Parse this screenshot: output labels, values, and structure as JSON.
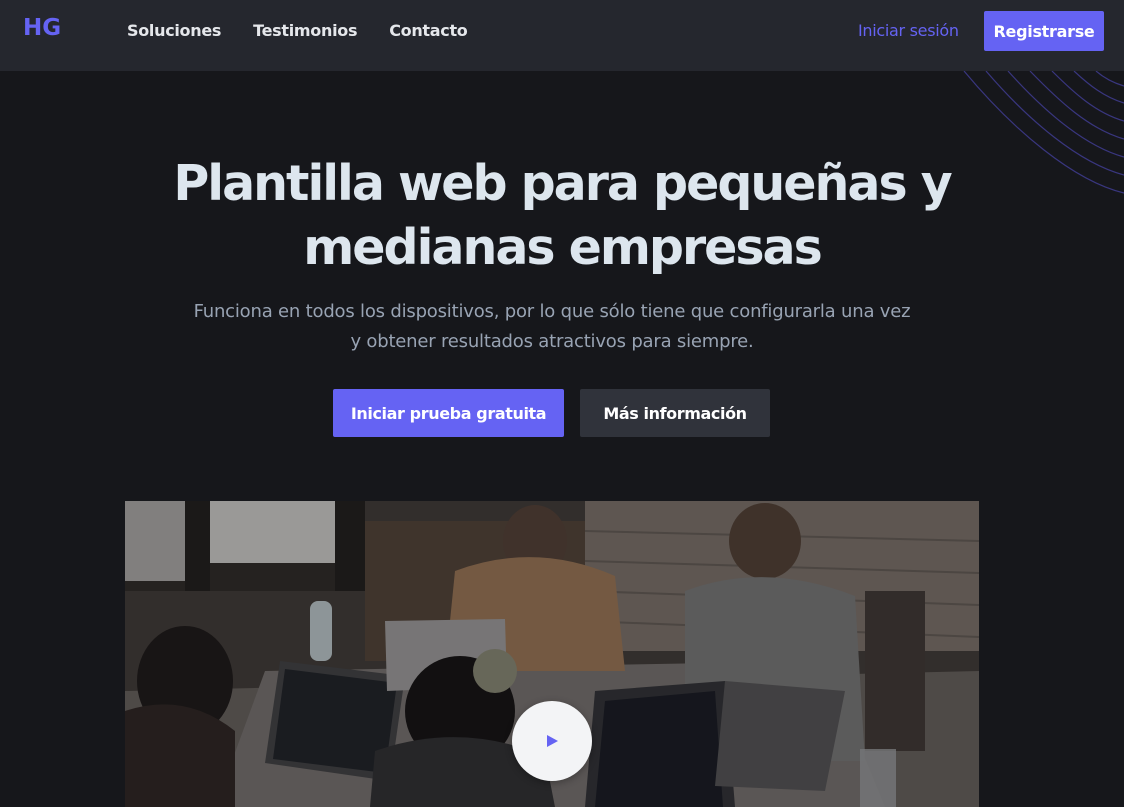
{
  "header": {
    "logo": "HG",
    "nav": [
      "Soluciones",
      "Testimonios",
      "Contacto"
    ],
    "login_label": "Iniciar sesión",
    "register_label": "Registrarse"
  },
  "hero": {
    "title_line1": "Plantilla web para pequeñas y",
    "title_line2": "medianas empresas",
    "subtitle_line1": "Funciona en todos los dispositivos, por lo que sólo tiene que configurarla una vez",
    "subtitle_line2": "y obtener resultados atractivos para siempre.",
    "primary_cta": "Iniciar prueba gratuita",
    "secondary_cta": "Más información"
  },
  "video": {
    "play_icon": "play-icon",
    "image": "people-working-on-laptops-photo"
  },
  "colors": {
    "accent": "#6563f3",
    "background": "#16171b",
    "header": "#25272e",
    "title": "#dde6ee",
    "subtitle": "#98a3b3"
  }
}
